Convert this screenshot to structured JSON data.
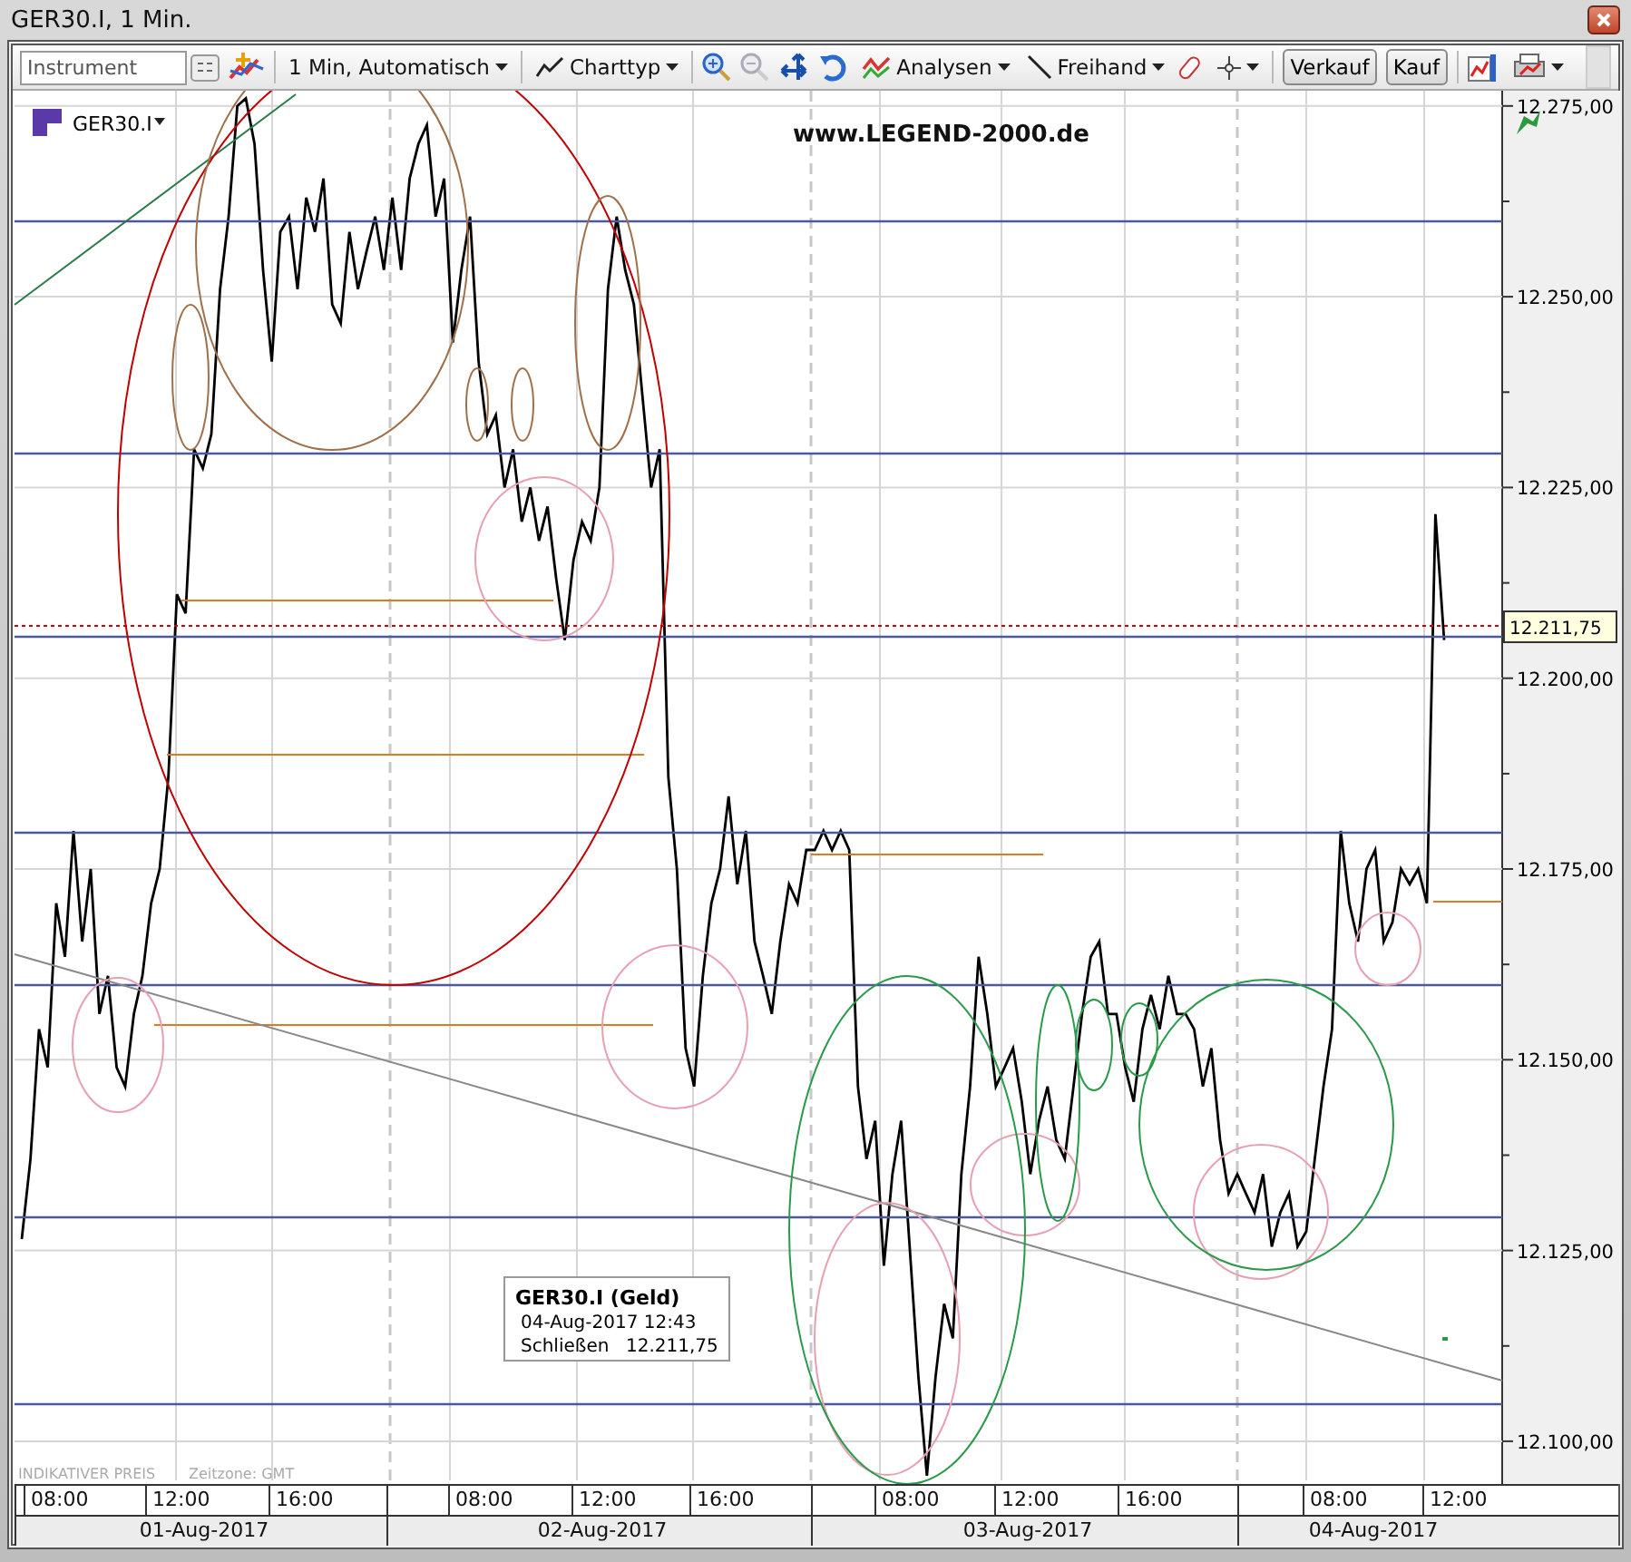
{
  "window": {
    "title": "GER30.I, 1 Min."
  },
  "toolbar": {
    "instrument_placeholder": "Instrument",
    "timeframe": "1 Min,  Automatisch",
    "chart_type": "Charttyp",
    "analyses": "Analysen",
    "freehand": "Freihand",
    "sell": "Verkauf",
    "buy": "Kauf"
  },
  "chart": {
    "overlay_text": "www.LEGEND-2000.de",
    "chart_data": {
      "type": "line",
      "ylim": [
        12094.4,
        12277
      ],
      "grid": true,
      "yticks": [
        {
          "value": 12275,
          "label": "12.275,00"
        },
        {
          "value": 12250,
          "label": "12.250,00"
        },
        {
          "value": 12225,
          "label": "12.225,00"
        },
        {
          "value": 12200,
          "label": "12.200,00"
        },
        {
          "value": 12175,
          "label": "12.175,00"
        },
        {
          "value": 12150,
          "label": "12.150,00"
        },
        {
          "value": 12125,
          "label": "12.125,00"
        },
        {
          "value": 12100,
          "label": "12.100,00"
        }
      ],
      "series": [
        {
          "name": "GER30.I",
          "color": "#000000",
          "values": [
            12126.5,
            12137,
            12154,
            12149,
            12170.5,
            12163.5,
            12180,
            12165.5,
            12175,
            12156,
            12161,
            12149,
            12146.5,
            12156,
            12161,
            12170.5,
            12175,
            12187,
            12211,
            12208.5,
            12230,
            12227.5,
            12232,
            12251,
            12260.5,
            12275,
            12276,
            12270,
            12253.5,
            12241.5,
            12258.5,
            12260.5,
            12251,
            12263,
            12258.5,
            12265.5,
            12249,
            12246.5,
            12258.5,
            12251,
            12256,
            12260.5,
            12253.5,
            12263,
            12253.5,
            12265.5,
            12270,
            12272.5,
            12260.5,
            12265.5,
            12244,
            12253.5,
            12260.5,
            12241.5,
            12232,
            12234.5,
            12225,
            12230,
            12220.5,
            12225,
            12218,
            12222.5,
            12213,
            12205,
            12215.5,
            12220.5,
            12218,
            12225,
            12251,
            12260.5,
            12253.5,
            12249,
            12237,
            12225,
            12230,
            12187,
            12175,
            12151.5,
            12146.5,
            12161,
            12170.5,
            12175,
            12184.5,
            12173,
            12180,
            12165.5,
            12161,
            12156,
            12165.5,
            12173,
            12170.5,
            12177.5,
            12177.5,
            12180,
            12177.5,
            12180,
            12177.5,
            12146.5,
            12137,
            12142,
            12123,
            12135,
            12142,
            12125.5,
            12108.5,
            12095.5,
            12108.5,
            12118,
            12113.5,
            12135,
            12146.5,
            12163.5,
            12156,
            12146.5,
            12149,
            12151.5,
            12144.5,
            12135,
            12142,
            12146.5,
            12139.5,
            12137,
            12146.5,
            12156,
            12163.5,
            12165.5,
            12156,
            12156,
            12149,
            12144.5,
            12154,
            12158.5,
            12154,
            12161,
            12156,
            12156,
            12154,
            12146.5,
            12151.5,
            12139.5,
            12132.5,
            12135,
            12132.5,
            12130,
            12135,
            12125.5,
            12130,
            12132.5,
            12125.5,
            12127.5,
            12137,
            12146.5,
            12154,
            12180,
            12170.5,
            12165.5,
            12175,
            12177.5,
            12165.5,
            12168,
            12175,
            12173,
            12175,
            12170.5,
            12221.5,
            12205
          ]
        }
      ]
    },
    "current_price": "12.211,75",
    "tooltip": {
      "title": "GER30.I (Geld)",
      "time": "04-Aug-2017 12:43",
      "label": "Schließen",
      "value": "12.211,75"
    },
    "footer": "INDIKATIVER PREIS",
    "timezone": "Zeitzone: GMT"
  },
  "time_axis": {
    "days": [
      {
        "date": "01-Aug-2017",
        "hours": [
          "08:00",
          "12:00",
          "16:00"
        ]
      },
      {
        "date": "02-Aug-2017",
        "hours": [
          "08:00",
          "12:00",
          "16:00"
        ]
      },
      {
        "date": "03-Aug-2017",
        "hours": [
          "08:00",
          "12:00",
          "16:00"
        ]
      },
      {
        "date": "04-Aug-2017",
        "hours": [
          "08:00",
          "12:00"
        ]
      }
    ]
  }
}
